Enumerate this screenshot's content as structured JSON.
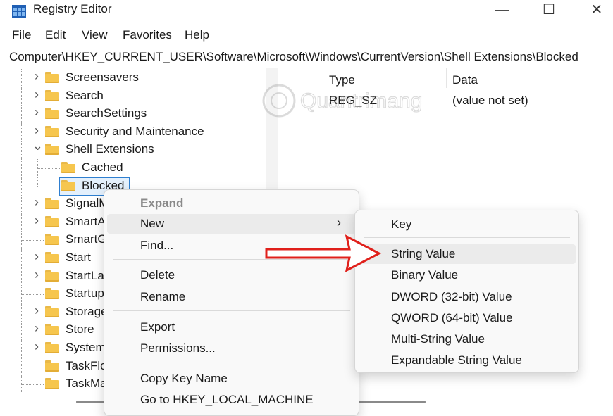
{
  "window": {
    "title": "Registry Editor",
    "controls": {
      "minimize": "—",
      "maximize": "☐",
      "close": "✕"
    }
  },
  "menu": [
    "File",
    "Edit",
    "View",
    "Favorites",
    "Help"
  ],
  "address": "Computer\\HKEY_CURRENT_USER\\Software\\Microsoft\\Windows\\CurrentVersion\\Shell Extensions\\Blocked",
  "tree": [
    {
      "label": "Screensavers",
      "state": "collapsed"
    },
    {
      "label": "Search",
      "state": "collapsed"
    },
    {
      "label": "SearchSettings",
      "state": "collapsed"
    },
    {
      "label": "Security and Maintenance",
      "state": "collapsed"
    },
    {
      "label": "Shell Extensions",
      "state": "expanded"
    },
    {
      "label": "Cached",
      "state": "leaf"
    },
    {
      "label": "Blocked",
      "state": "selected"
    },
    {
      "label": "SignalM",
      "state": "collapsed"
    },
    {
      "label": "SmartA",
      "state": "collapsed"
    },
    {
      "label": "SmartG",
      "state": "leaf"
    },
    {
      "label": "Start",
      "state": "collapsed"
    },
    {
      "label": "StartLa",
      "state": "collapsed"
    },
    {
      "label": "Startup",
      "state": "leaf"
    },
    {
      "label": "Storage",
      "state": "collapsed"
    },
    {
      "label": "Store",
      "state": "collapsed"
    },
    {
      "label": "System",
      "state": "collapsed"
    },
    {
      "label": "TaskFlo",
      "state": "leaf"
    },
    {
      "label": "TaskMa",
      "state": "leaf"
    }
  ],
  "values_pane": {
    "headers": {
      "type": "Type",
      "data": "Data"
    },
    "rows": [
      {
        "type": "REG_SZ",
        "data": "(value not set)"
      }
    ]
  },
  "watermark": "Quantrimang",
  "context_menu": {
    "items": [
      {
        "label": "Expand",
        "disabled": true
      },
      {
        "label": "New",
        "submenu": true,
        "arrow": "›"
      },
      {
        "label": "Find..."
      },
      {
        "label": "Delete"
      },
      {
        "label": "Rename"
      },
      {
        "label": "Export"
      },
      {
        "label": "Permissions..."
      },
      {
        "label": "Copy Key Name"
      },
      {
        "label": "Go to HKEY_LOCAL_MACHINE"
      }
    ]
  },
  "submenu": {
    "items": [
      {
        "label": "Key"
      },
      {
        "label": "String Value",
        "highlighted": true
      },
      {
        "label": "Binary Value"
      },
      {
        "label": "DWORD (32-bit) Value"
      },
      {
        "label": "QWORD (64-bit) Value"
      },
      {
        "label": "Multi-String Value"
      },
      {
        "label": "Expandable String Value"
      }
    ]
  },
  "colors": {
    "folder": "#f6c64e",
    "selection_border": "#2f7fd0",
    "annotation_arrow": "#e0201b",
    "submenu_highlight": "#ebebeb"
  }
}
